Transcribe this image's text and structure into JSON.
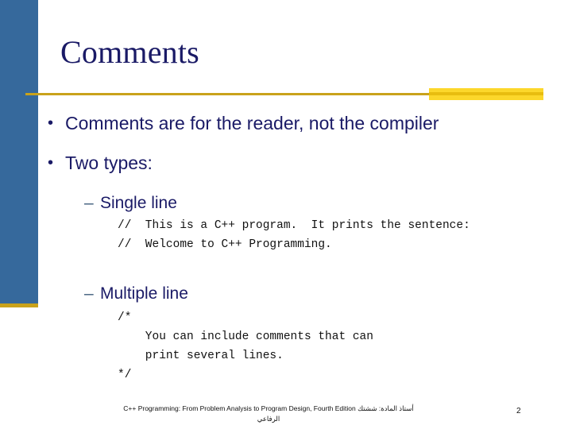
{
  "slide": {
    "title": "Comments",
    "page_number": "2",
    "colors": {
      "accent_blue": "#36699c",
      "accent_gold": "#c9a21b",
      "accent_yellow": "#fcd72b",
      "title_navy": "#1a1a66",
      "dash_steel": "#43617f"
    }
  },
  "bullets": [
    {
      "marker": "•",
      "text": "Comments are for the reader, not the compiler"
    },
    {
      "marker": "•",
      "text": "Two types:"
    }
  ],
  "subsections": [
    {
      "marker": "–",
      "heading": "Single line",
      "code": "//  This is a C++ program.  It prints the sentence:\n//  Welcome to C++ Programming."
    },
    {
      "marker": "–",
      "heading": "Multiple line",
      "code": "/*\n    You can include comments that can\n    print several lines.\n*/"
    }
  ],
  "footer": {
    "line1": "C++ Programming: From Problem Analysis to Program Design, Fourth Edition أستاذ المادة: ششتك",
    "line2": "الرفاعي"
  }
}
